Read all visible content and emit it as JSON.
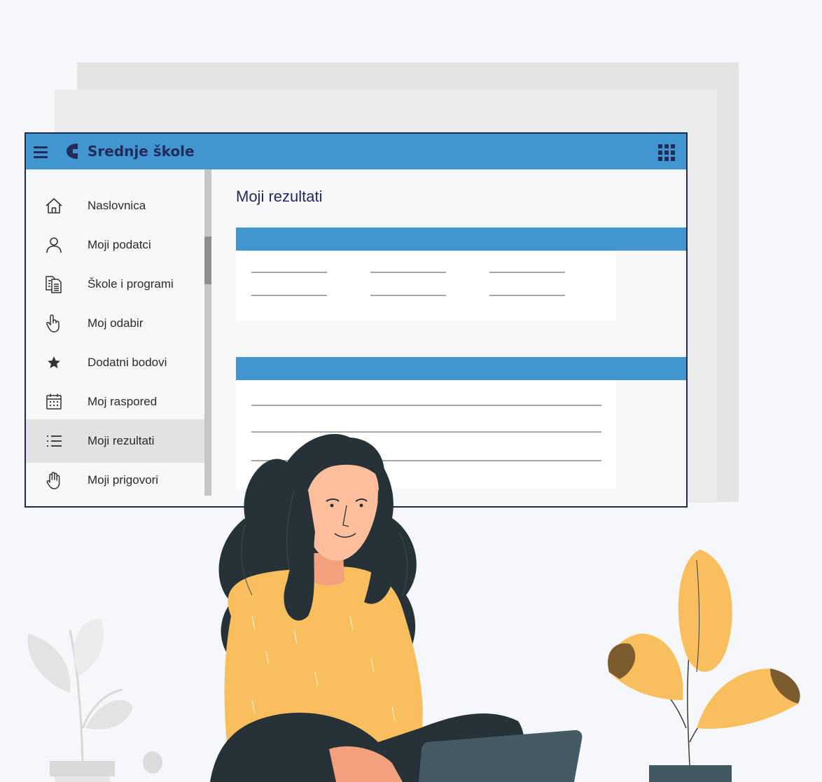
{
  "app": {
    "title": "Srednje škole"
  },
  "sidebar": {
    "items": [
      {
        "label": "Naslovnica",
        "icon": "home-icon"
      },
      {
        "label": "Moji podatci",
        "icon": "user-icon"
      },
      {
        "label": "Škole i programi",
        "icon": "documents-icon"
      },
      {
        "label": "Moj odabir",
        "icon": "pointer-hand-icon"
      },
      {
        "label": "Dodatni bodovi",
        "icon": "star-icon"
      },
      {
        "label": "Moj raspored",
        "icon": "calendar-icon"
      },
      {
        "label": "Moji rezultati",
        "icon": "list-icon",
        "active": true
      },
      {
        "label": "Moji prigovori",
        "icon": "raised-hand-icon"
      }
    ]
  },
  "main": {
    "title": "Moji rezultati"
  },
  "colors": {
    "topbar": "#4196d0",
    "brand_navy": "#232a5c",
    "active_item": "#e2e2e2",
    "page_background": "#f5f7fa"
  }
}
